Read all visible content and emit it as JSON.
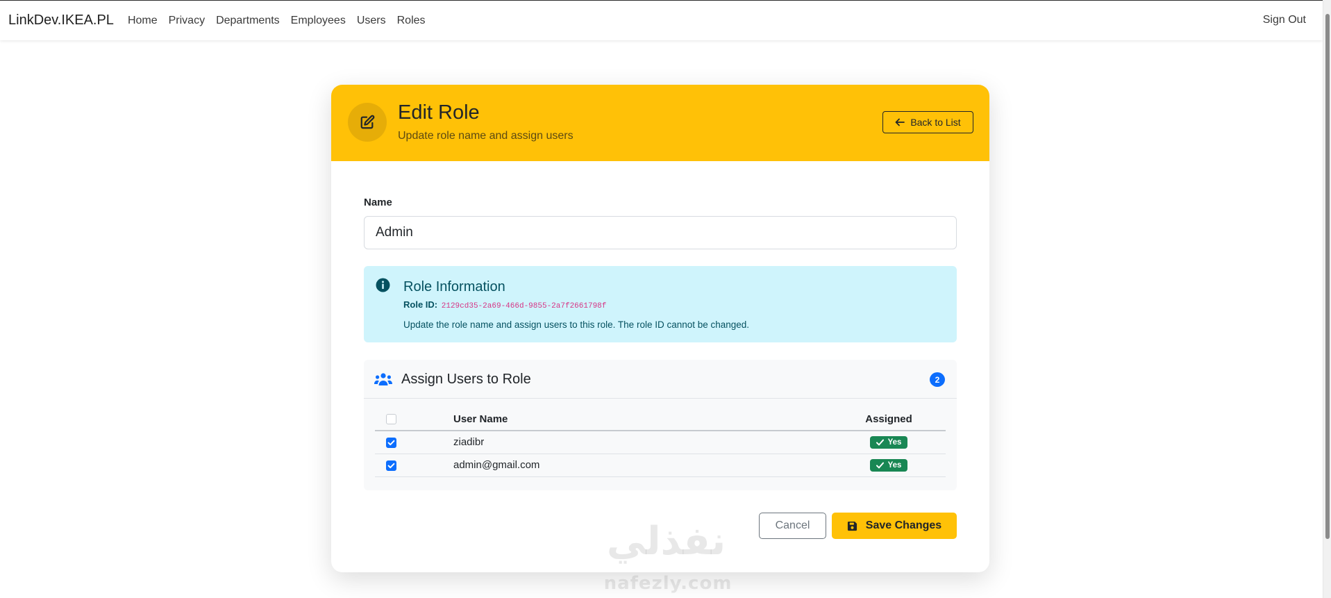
{
  "navbar": {
    "brand": "LinkDev.IKEA.PL",
    "links": [
      "Home",
      "Privacy",
      "Departments",
      "Employees",
      "Users",
      "Roles"
    ],
    "sign_out": "Sign Out"
  },
  "header": {
    "title": "Edit Role",
    "subtitle": "Update role name and assign users",
    "back_button": "Back to List",
    "icon": "edit-icon"
  },
  "form": {
    "name_label": "Name",
    "name_value": "Admin"
  },
  "info": {
    "title": "Role Information",
    "role_id_label": "Role ID:",
    "role_id": "2129cd35-2a69-466d-9855-2a7f2661798f",
    "text": "Update the role name and assign users to this role. The role ID cannot be changed."
  },
  "assign": {
    "title": "Assign Users to Role",
    "count": "2",
    "columns": [
      "User Name",
      "Assigned"
    ],
    "rows": [
      {
        "user": "ziadibr",
        "assigned": "Yes",
        "checked": true
      },
      {
        "user": "admin@gmail.com",
        "assigned": "Yes",
        "checked": true
      }
    ]
  },
  "actions": {
    "cancel": "Cancel",
    "save": "Save Changes"
  },
  "watermark": {
    "arabic": "نفذلي",
    "latin": "nafezly.com"
  },
  "colors": {
    "warning": "#ffc107",
    "info_bg": "#cff4fc",
    "primary": "#0d6efd",
    "success": "#198754"
  }
}
